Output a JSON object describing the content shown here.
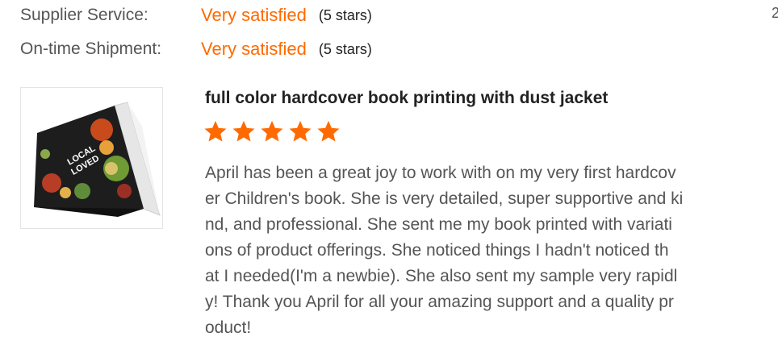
{
  "ratings": [
    {
      "label": "Supplier Service:",
      "value": "Very satisfied",
      "stars_text": "(5 stars)"
    },
    {
      "label": "On-time Shipment:",
      "value": "Very satisfied",
      "stars_text": "(5 stars)"
    }
  ],
  "edge_text": "2",
  "review": {
    "title": "full color hardcover book printing with dust jacket",
    "stars": 5,
    "image_book_text": "LOCAL LOVED",
    "text_lines": [
      "April has been a great joy to work with on my very first hardcov",
      "er Children's book. She is very detailed, super supportive and ki",
      "nd, and professional. She sent me my book printed with variati",
      "ons of product offerings. She noticed things I hadn't noticed th",
      "at I needed(I'm a newbie). She also sent my sample very rapidl",
      "y! Thank you April for all your amazing support and a quality pr",
      "oduct!"
    ]
  },
  "colors": {
    "accent": "#ff6a00",
    "label": "#555555",
    "title": "#222222"
  }
}
